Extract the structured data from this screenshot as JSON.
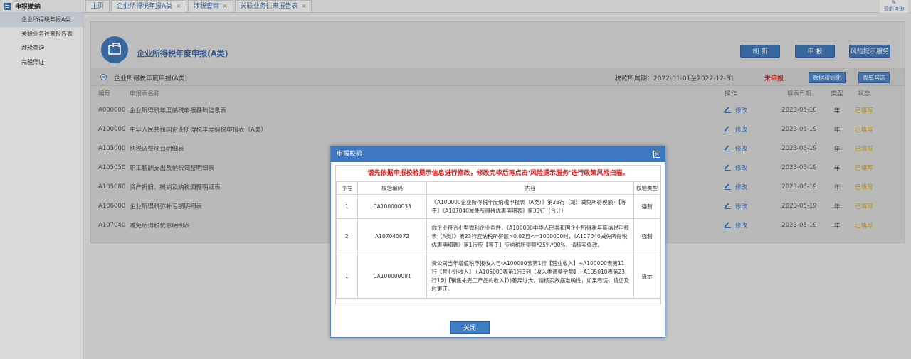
{
  "sidebar": {
    "header": "申报缴纳",
    "items": [
      {
        "label": "企业所得税年报A类",
        "active": true
      },
      {
        "label": "关联业务往来报告表",
        "active": false
      },
      {
        "label": "涉税查询",
        "active": false
      },
      {
        "label": "完税凭证",
        "active": false
      }
    ]
  },
  "tabs": [
    {
      "label": "主页",
      "closable": false
    },
    {
      "label": "企业所得税年报A类",
      "closable": true,
      "active": true
    },
    {
      "label": "涉税查询",
      "closable": true
    },
    {
      "label": "关联业务往来报告表",
      "closable": true
    }
  ],
  "assistant": {
    "label": "智能咨询"
  },
  "panel": {
    "title": "企业所得税年度申报(A类)",
    "buttons": {
      "refresh": "刷 新",
      "declare": "申 报",
      "risk": "风险提示服务"
    }
  },
  "subbar": {
    "title": "企业所得税年度申报(A类)",
    "period": "税款所属期：2022-01-01至2022-12-31",
    "status": "未申报",
    "init_button": "数据初始化",
    "check_button": "表单勾选"
  },
  "table": {
    "headers": {
      "code": "编号",
      "name": "申报表名称",
      "op": "操作",
      "date": "填表日期",
      "type": "类型",
      "state": "状态"
    },
    "rows": [
      {
        "code": "A000000",
        "name": "企业所得税年度纳税申报基础信息表",
        "op": "修改",
        "date": "2023-05-10",
        "type": "年",
        "state": "已填写"
      },
      {
        "code": "A100000",
        "name": "中华人民共和国企业所得税年度纳税申报表（A类）",
        "op": "修改",
        "date": "2023-05-19",
        "type": "年",
        "state": "已填写"
      },
      {
        "code": "A105000",
        "name": "纳税调整项目明细表",
        "op": "修改",
        "date": "2023-05-19",
        "type": "年",
        "state": "已填写"
      },
      {
        "code": "A105050",
        "name": "职工薪酬支出及纳税调整明细表",
        "op": "修改",
        "date": "2023-05-19",
        "type": "年",
        "state": "已填写"
      },
      {
        "code": "A105080",
        "name": "资产折旧、摊销及纳税调整明细表",
        "op": "修改",
        "date": "2023-05-19",
        "type": "年",
        "state": "已填写"
      },
      {
        "code": "A106000",
        "name": "企业所得税弥补亏损明细表",
        "op": "修改",
        "date": "2023-05-19",
        "type": "年",
        "state": "已填写"
      },
      {
        "code": "A107040",
        "name": "减免所得税优惠明细表",
        "op": "修改",
        "date": "2023-05-19",
        "type": "年",
        "state": "已填写"
      }
    ]
  },
  "dialog": {
    "title": "申报校验",
    "warning": "请先依据申报校验提示信息进行修改，修改完毕后再点击‘风险提示服务’进行政策风险扫描。",
    "headers": {
      "no": "序号",
      "code": "校验编码",
      "content": "内容",
      "type": "校验类型"
    },
    "rows": [
      {
        "no": "1",
        "code": "CA100000033",
        "content": "《A100000企业所得税年度纳税申报表（A类）》第26行（减：减免所得税额）【等于】《A107040减免所得税优惠明细表》第33行（合计）",
        "type": "强制"
      },
      {
        "no": "2",
        "code": "A107040072",
        "content": "你企业符合小型微利企业条件，《A100000中华人民共和国企业所得税年度纳税申报表（A类）》第23行应纳税所得额>0.02且<=1000000时，《A107040减免所得税优惠明细表》第1行应【等于】应纳税所得额*25%*90%，请核实修改。",
        "type": "强制"
      },
      {
        "no": "1",
        "code": "CA100000081",
        "content": "贵公司当年增值税申报收入与(A100000表第1行【营业收入】+A100000表第11行【营业外收入】+A105000表第1行3列【收入类调整金额】+A105010表第23行1列【销售未完工产品的收入】）)差异过大，请核实数据准确性，如果有误，请您及时更正。",
        "type": "提示"
      }
    ],
    "close_button": "关闭"
  }
}
